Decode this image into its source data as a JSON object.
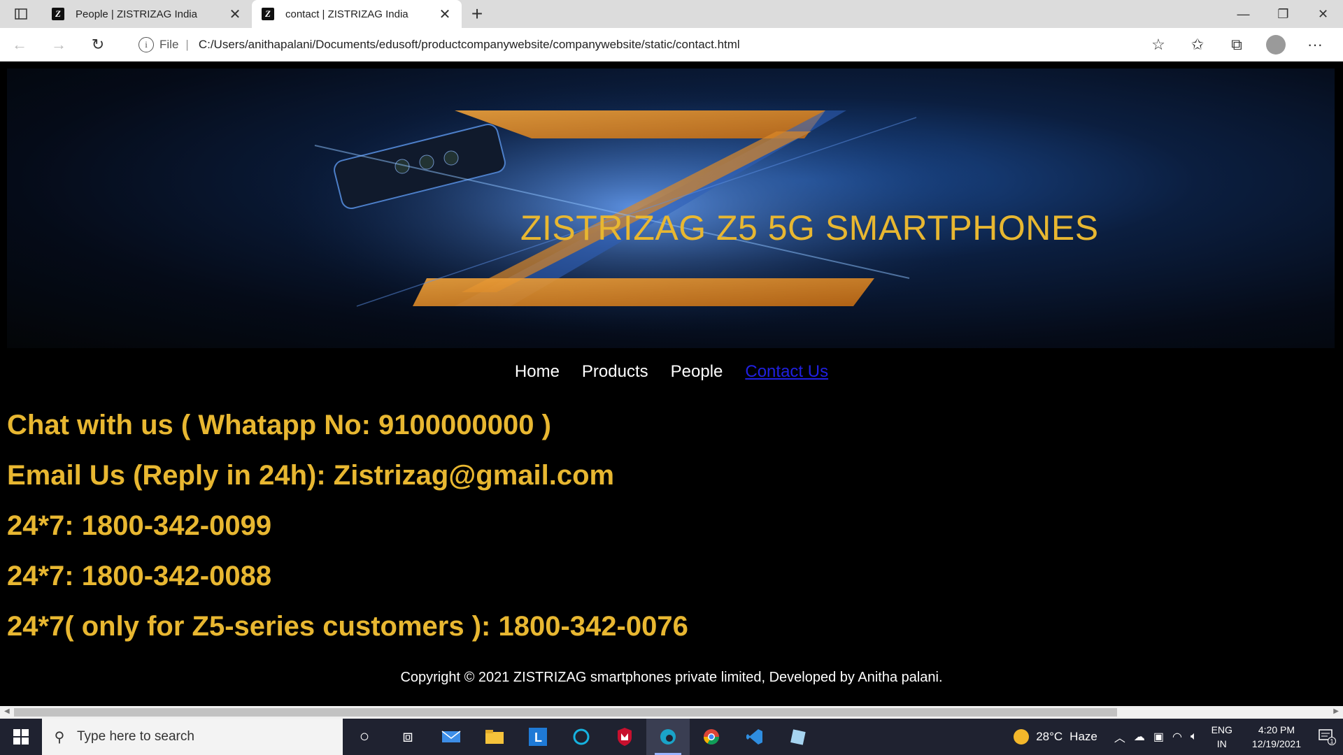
{
  "browser": {
    "tabs": [
      {
        "title": "People | ZISTRIZAG India",
        "active": false
      },
      {
        "title": "contact | ZISTRIZAG India",
        "active": true
      }
    ],
    "address": {
      "scheme_label": "File",
      "url": "C:/Users/anithapalani/Documents/edusoft/productcompanywebsite/companywebsite/static/contact.html"
    }
  },
  "page": {
    "banner_title": "ZISTRIZAG Z5 5G SMARTPHONES",
    "nav": {
      "home": "Home",
      "products": "Products",
      "people": "People",
      "contact": "Contact Us"
    },
    "contacts": {
      "chat": "Chat with us ( Whatapp No: 9100000000 )",
      "email": "Email Us (Reply in 24h): Zistrizag@gmail.com",
      "line1": "24*7: 1800-342-0099",
      "line2": "24*7: 1800-342-0088",
      "line3": "24*7( only for Z5-series customers ): 1800-342-0076"
    },
    "footer": "Copyright © 2021 ZISTRIZAG smartphones private limited, Developed by Anitha palani."
  },
  "taskbar": {
    "search_placeholder": "Type here to search",
    "weather": {
      "temp": "28°C",
      "condition": "Haze"
    },
    "lang": {
      "line1": "ENG",
      "line2": "IN"
    },
    "clock": {
      "time": "4:20 PM",
      "date": "12/19/2021"
    },
    "notification_count": "1"
  },
  "colors": {
    "accent_gold": "#e8b731",
    "link_blue": "#2020e0"
  }
}
